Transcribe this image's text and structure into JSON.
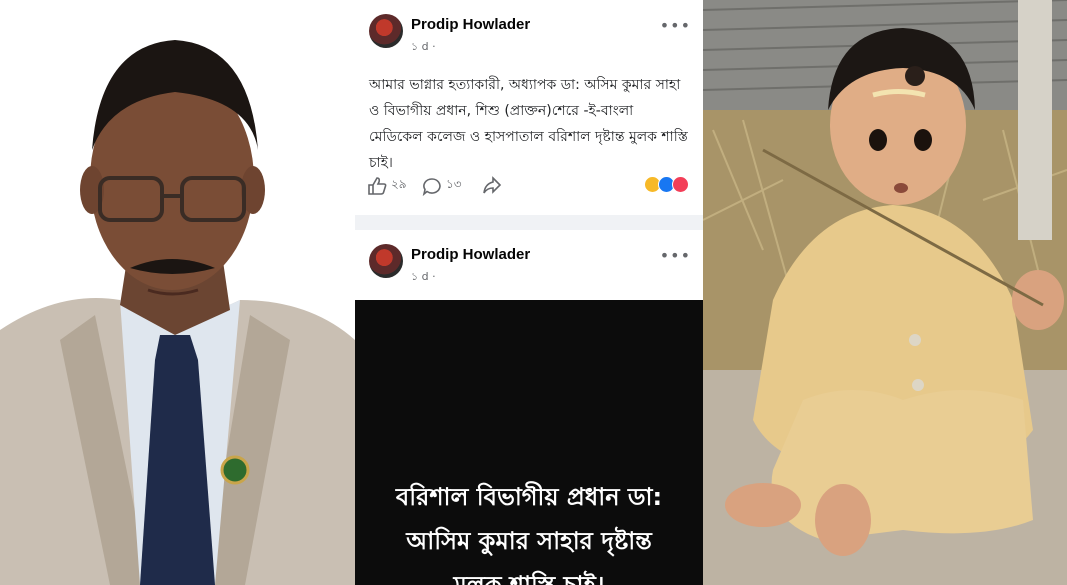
{
  "posts": [
    {
      "author": "Prodip Howlader",
      "time": "১ d ·",
      "more_icon": "more-options-icon",
      "text": "আমার ভাগ্নার হত্যাকারী, অধ্যাপক ডা: অসিম কুমার সাহা ও বিভাগীয় প্রধান, শিশু (প্রাক্তন)শেরে -ই-বাংলা মেডিকেল কলেজ ও হাসপাতাল বরিশাল দৃষ্টান্ত মুলক শাস্তি চাই।",
      "like_count": "২৯",
      "comment_count": "১৩",
      "reactions": [
        "haha",
        "like",
        "love"
      ]
    },
    {
      "author": "Prodip Howlader",
      "time": "১ d ·",
      "more_icon": "more-options-icon",
      "banner_lines": [
        "বরিশাল বিভাগীয় প্রধান ডা:",
        "আসিম কুমার সাহার দৃষ্টান্ত",
        "মুলক শাস্তি চাই।"
      ]
    }
  ],
  "colors": {
    "feed_bg": "#f0f2f5",
    "banner_bg": "#0c0c0c",
    "banner_text": "#ffffff",
    "muted": "#65676b",
    "like_blue": "#1877f2",
    "love_red": "#f33e58",
    "haha_yellow": "#f7b928"
  }
}
